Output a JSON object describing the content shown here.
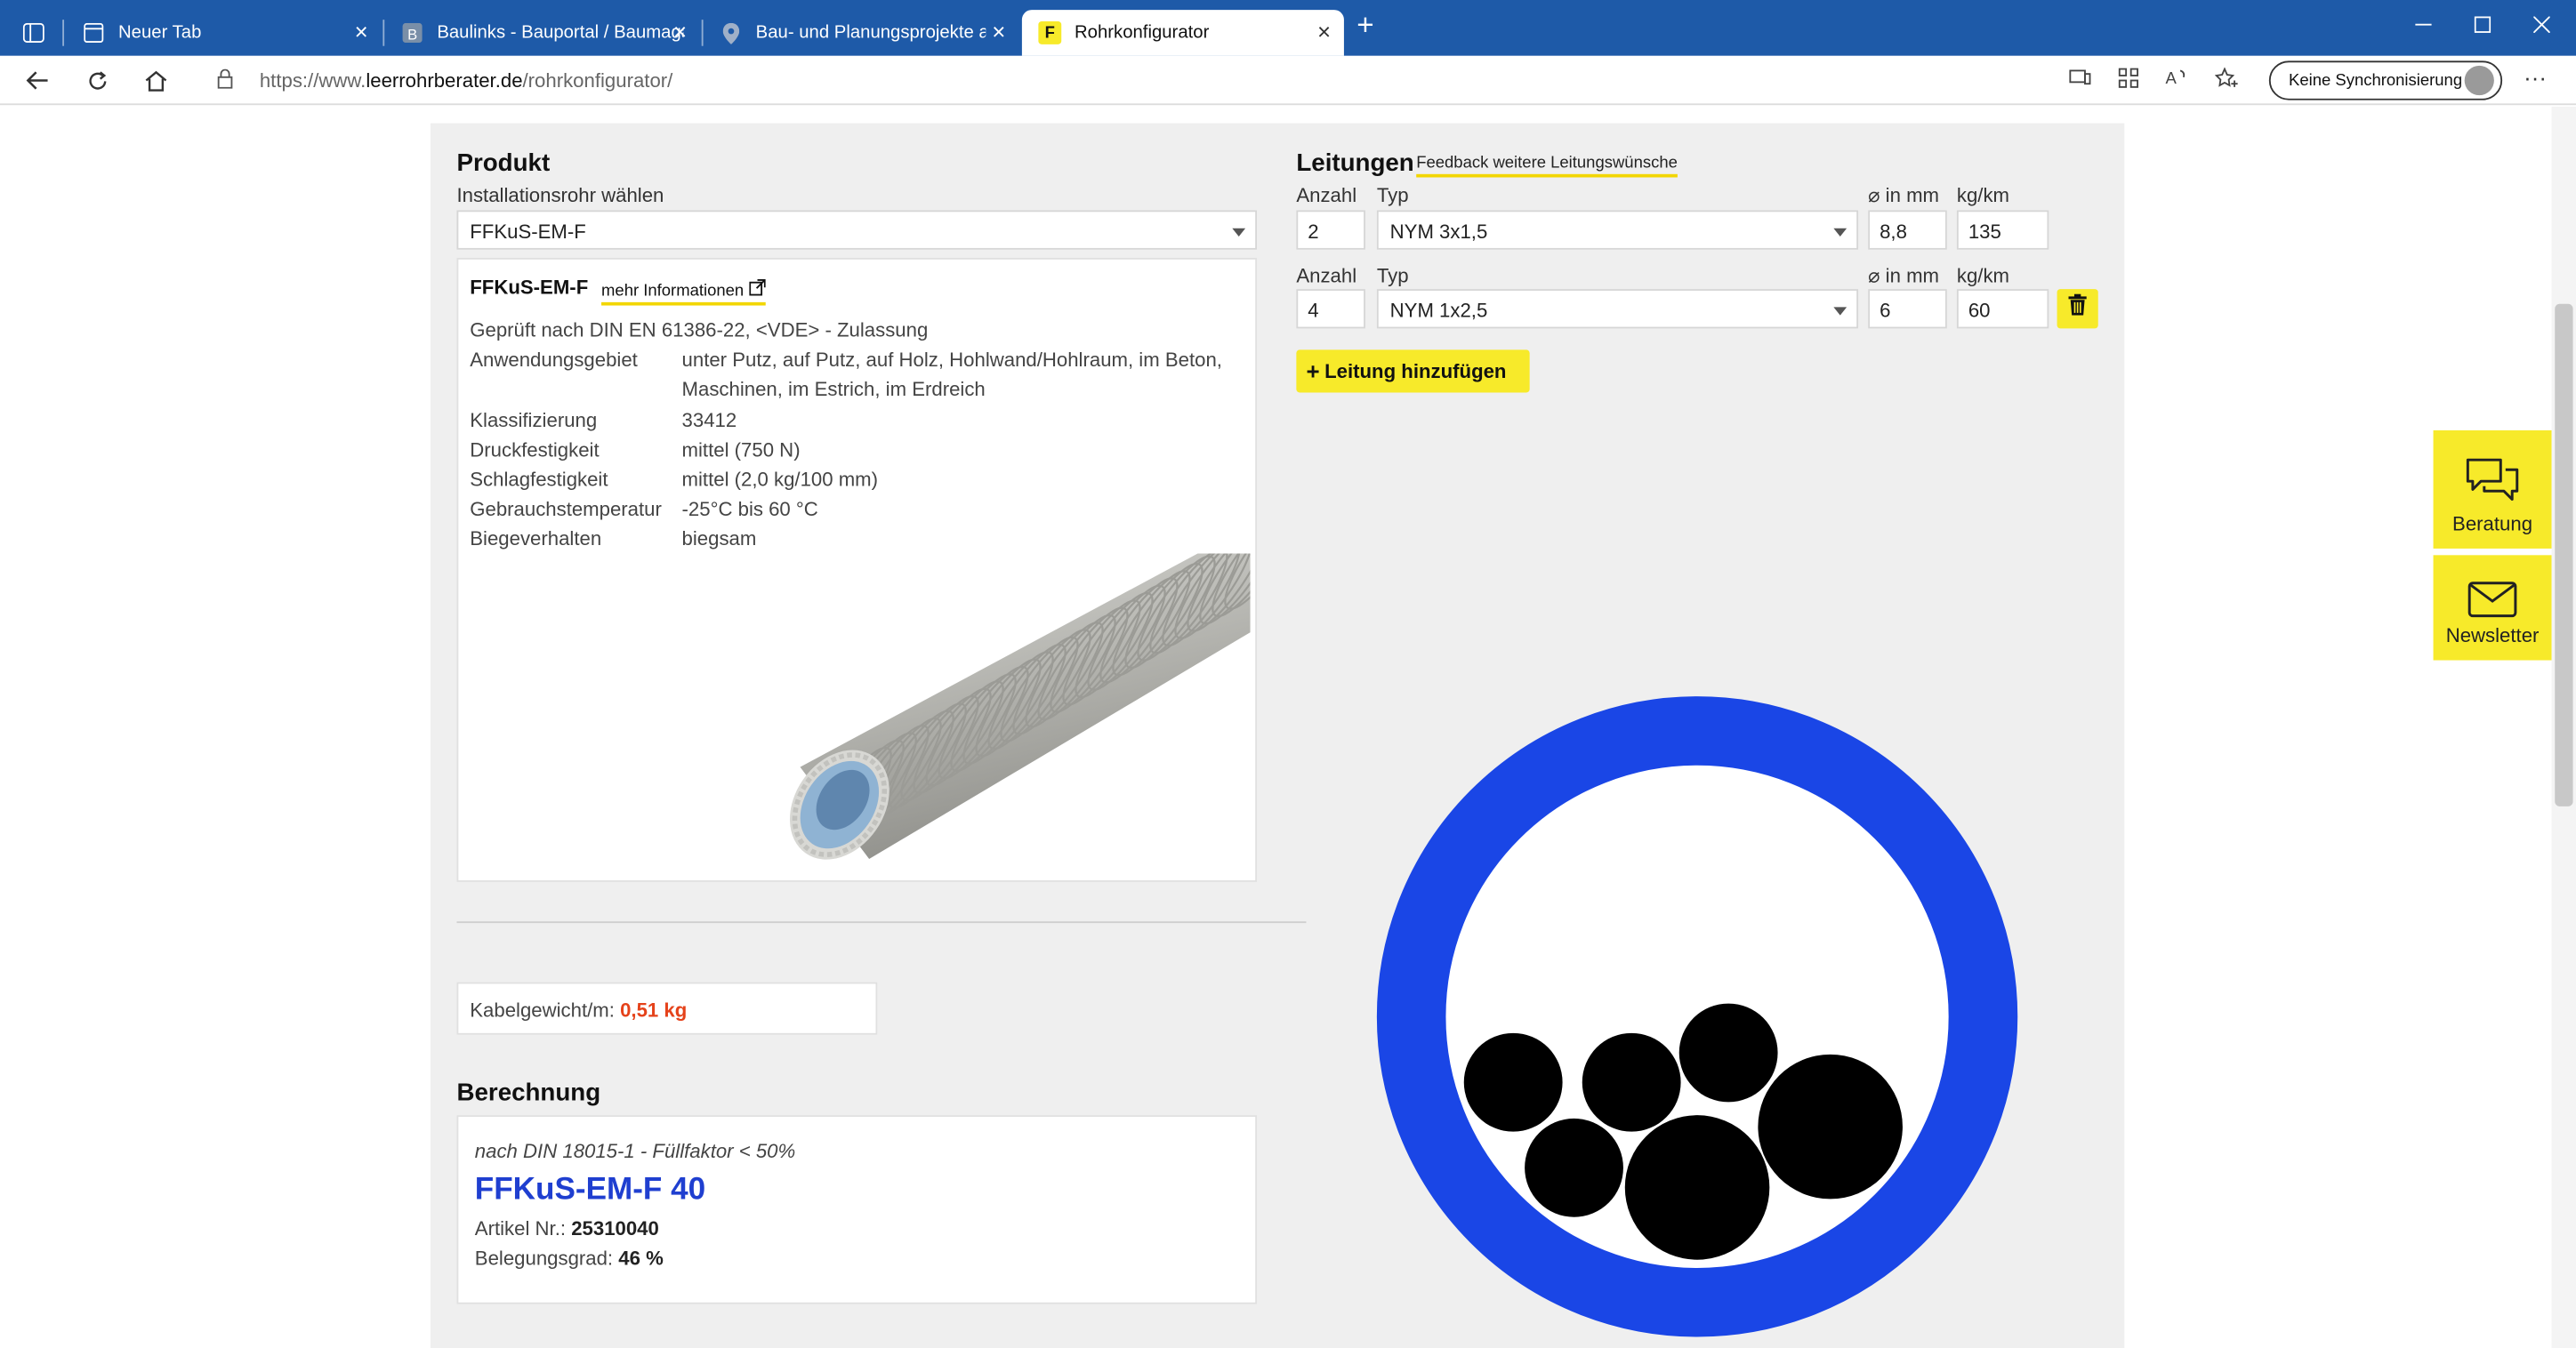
{
  "browser": {
    "tabs": [
      {
        "label": "Neuer Tab"
      },
      {
        "label": "Baulinks - Bauportal / Baumagaz"
      },
      {
        "label": "Bau- und Planungsprojekte auf B"
      },
      {
        "label": "Rohrkonfigurator"
      }
    ],
    "url_prefix": "https://www.",
    "url_domain": "leerrohrberater.de",
    "url_path": "/rohrkonfigurator/",
    "sync_label": "Keine Synchronisierung",
    "active_tab_icon": "F"
  },
  "produkt": {
    "heading": "Produkt",
    "select_label": "Installationsrohr wählen",
    "selected": "FFKuS-EM-F",
    "card_title": "FFKuS-EM-F",
    "more_link": "mehr Informationen",
    "tested": "Geprüft nach DIN EN 61386-22, <VDE> - Zulassung",
    "specs": [
      {
        "key": "Anwendungsgebiet",
        "value": "unter Putz, auf Putz, auf Holz, Hohlwand/Hohlraum, im Beton, Maschinen, im Estrich, im Erdreich"
      },
      {
        "key": "Klassifizierung",
        "value": "33412"
      },
      {
        "key": "Druckfestigkeit",
        "value": "mittel (750 N)"
      },
      {
        "key": "Schlagfestigkeit",
        "value": "mittel (2,0 kg/100 mm)"
      },
      {
        "key": "Gebrauchstemperatur",
        "value": "-25°C bis 60 °C"
      },
      {
        "key": "Biegeverhalten",
        "value": "biegsam"
      }
    ]
  },
  "gewicht": {
    "label": "Kabelgewicht/m: ",
    "value": "0,51 kg"
  },
  "berechnung": {
    "heading": "Berechnung",
    "norm": "nach DIN 18015-1 - Füllfaktor < 50%",
    "product": "FFKuS-EM-F 40",
    "artikel_label": "Artikel Nr.: ",
    "artikel_value": "25310040",
    "belegung_label": "Belegungsgrad: ",
    "belegung_value": "46 %"
  },
  "leitungen": {
    "heading": "Leitungen",
    "feedback_link": "Feedback weitere Leitungswünsche",
    "col_anzahl": "Anzahl",
    "col_typ": "Typ",
    "col_diameter": "⌀ in mm",
    "col_weight": "kg/km",
    "rows": [
      {
        "anzahl": "2",
        "typ": "NYM 3x1,5",
        "diameter": "8,8",
        "weight": "135"
      },
      {
        "anzahl": "4",
        "typ": "NYM 1x2,5",
        "diameter": "6",
        "weight": "60"
      }
    ],
    "add_button": "Leitung hinzufügen"
  },
  "side": {
    "beratung": "Beratung",
    "newsletter": "Newsletter"
  },
  "colors": {
    "tube": "#1a46e6",
    "accent": "#f7ea2a",
    "product": "#1f3fd0",
    "weight": "#e5421a"
  }
}
